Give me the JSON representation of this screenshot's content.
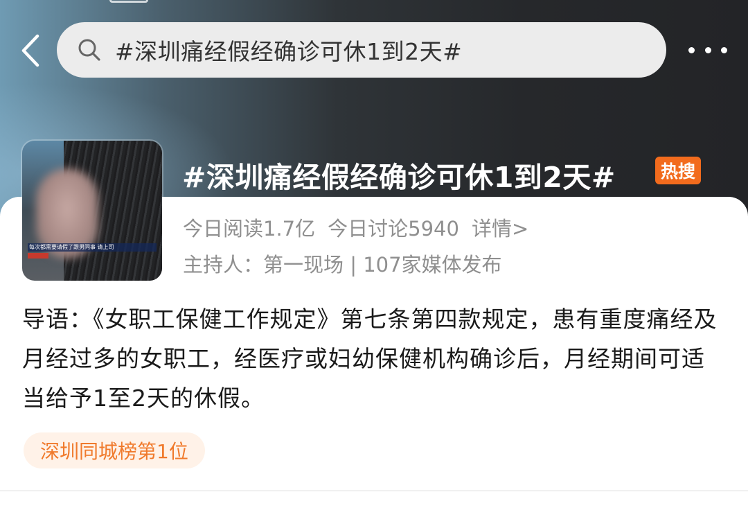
{
  "search": {
    "query": "#深圳痛经假经确诊可休1到2天#"
  },
  "topic": {
    "title": "#深圳痛经假经确诊可休1到2天#",
    "hot_badge": "热搜",
    "reads_today": "今日阅读1.7亿",
    "discussions_today": "今日讨论5940",
    "details_link": "详情>",
    "host": "主持人：第一现场 | 107家媒体发布",
    "thumbnail_caption": "每次都需要请假了跟男同事 请上司"
  },
  "intro": {
    "text": "导语：《女职工保健工作规定》第七条第四款规定，患有重度痛经及月经过多的女职工，经医疗或妇幼保健机构确诊后，月经期间可适当给予1至2天的休假。"
  },
  "rank_chip": {
    "label": "深圳同城榜第1位"
  },
  "icons": {
    "back": "chevron-left-icon",
    "search": "search-icon",
    "more": "more-dots-icon"
  },
  "colors": {
    "hot_badge": "#f26b1d",
    "rank_text": "#f07a2c",
    "rank_bg": "#fff2e8"
  }
}
